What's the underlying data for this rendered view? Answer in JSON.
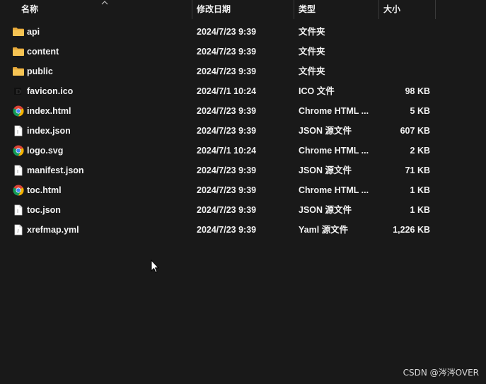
{
  "header": {
    "name_label": "名称",
    "date_label": "修改日期",
    "type_label": "类型",
    "size_label": "大小"
  },
  "files": [
    {
      "name": "api",
      "date": "2024/7/23 9:39",
      "type": "文件夹",
      "size": "",
      "icon": "folder-icon"
    },
    {
      "name": "content",
      "date": "2024/7/23 9:39",
      "type": "文件夹",
      "size": "",
      "icon": "folder-icon"
    },
    {
      "name": "public",
      "date": "2024/7/23 9:39",
      "type": "文件夹",
      "size": "",
      "icon": "folder-icon"
    },
    {
      "name": "favicon.ico",
      "date": "2024/7/1 10:24",
      "type": "ICO 文件",
      "size": "98 KB",
      "icon": "ico-file-icon"
    },
    {
      "name": "index.html",
      "date": "2024/7/23 9:39",
      "type": "Chrome HTML ...",
      "size": "5 KB",
      "icon": "chrome-icon"
    },
    {
      "name": "index.json",
      "date": "2024/7/23 9:39",
      "type": "JSON 源文件",
      "size": "607 KB",
      "icon": "document-icon"
    },
    {
      "name": "logo.svg",
      "date": "2024/7/1 10:24",
      "type": "Chrome HTML ...",
      "size": "2 KB",
      "icon": "chrome-icon"
    },
    {
      "name": "manifest.json",
      "date": "2024/7/23 9:39",
      "type": "JSON 源文件",
      "size": "71 KB",
      "icon": "document-icon"
    },
    {
      "name": "toc.html",
      "date": "2024/7/23 9:39",
      "type": "Chrome HTML ...",
      "size": "1 KB",
      "icon": "chrome-icon"
    },
    {
      "name": "toc.json",
      "date": "2024/7/23 9:39",
      "type": "JSON 源文件",
      "size": "1 KB",
      "icon": "document-icon"
    },
    {
      "name": "xrefmap.yml",
      "date": "2024/7/23 9:39",
      "type": "Yaml 源文件",
      "size": "1,226 KB",
      "icon": "yaml-file-icon"
    }
  ],
  "watermark": "CSDN @涔涔OVER",
  "colors": {
    "background": "#191919",
    "folder": "#f4c04a",
    "text": "#f2f2f2"
  }
}
